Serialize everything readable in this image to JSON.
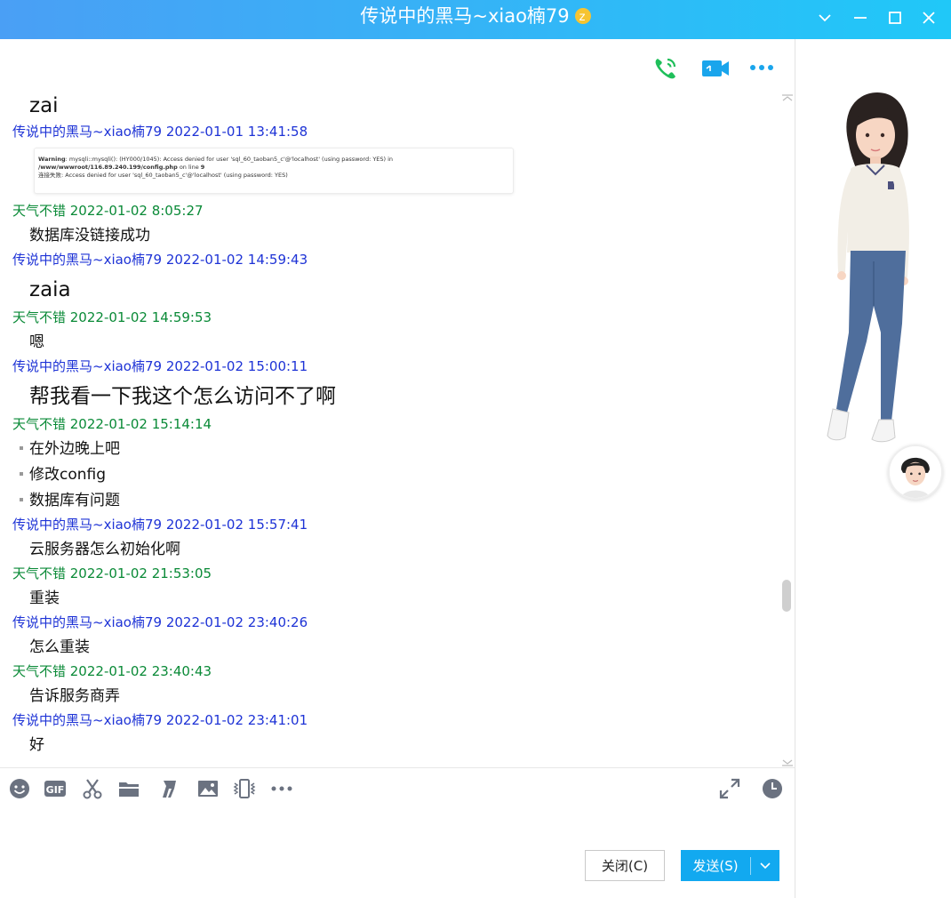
{
  "window": {
    "title": "传说中的黑马~xiao楠79"
  },
  "messages": [
    {
      "kind": "body",
      "size": "big",
      "text": "zai",
      "top": 0
    },
    {
      "kind": "meta",
      "who": "me",
      "text": "传说中的黑马~xiao楠79 2022-01-01 13:41:58"
    },
    {
      "kind": "meta",
      "who": "other",
      "text": "天气不错 2022-01-02 8:05:27"
    },
    {
      "kind": "body",
      "size": "norm",
      "text": "数据库没链接成功"
    },
    {
      "kind": "meta",
      "who": "me",
      "text": "传说中的黑马~xiao楠79 2022-01-02 14:59:43"
    },
    {
      "kind": "body",
      "size": "big",
      "text": "zaia"
    },
    {
      "kind": "meta",
      "who": "other",
      "text": "天气不错 2022-01-02 14:59:53"
    },
    {
      "kind": "body",
      "size": "norm",
      "text": "嗯"
    },
    {
      "kind": "meta",
      "who": "me",
      "text": "传说中的黑马~xiao楠79 2022-01-02 15:00:11"
    },
    {
      "kind": "body",
      "size": "big",
      "text": "帮我看一下我这个怎么访问不了啊"
    },
    {
      "kind": "meta",
      "who": "other",
      "text": "天气不错 2022-01-02 15:14:14"
    },
    {
      "kind": "bullet",
      "text": "在外边晚上吧"
    },
    {
      "kind": "bullet",
      "text": "修改config"
    },
    {
      "kind": "bullet",
      "text": "数据库有问题"
    },
    {
      "kind": "meta",
      "who": "me",
      "text": "传说中的黑马~xiao楠79 2022-01-02 15:57:41"
    },
    {
      "kind": "body",
      "size": "norm",
      "text": "云服务器怎么初始化啊"
    },
    {
      "kind": "meta",
      "who": "other",
      "text": "天气不错 2022-01-02 21:53:05"
    },
    {
      "kind": "body",
      "size": "norm",
      "text": "重装"
    },
    {
      "kind": "meta",
      "who": "me",
      "text": "传说中的黑马~xiao楠79 2022-01-02 23:40:26"
    },
    {
      "kind": "body",
      "size": "norm",
      "text": "怎么重装"
    },
    {
      "kind": "meta",
      "who": "other",
      "text": "天气不错 2022-01-02 23:40:43"
    },
    {
      "kind": "body",
      "size": "norm",
      "text": "告诉服务商弄"
    },
    {
      "kind": "meta",
      "who": "me",
      "text": "传说中的黑马~xiao楠79 2022-01-02 23:41:01"
    },
    {
      "kind": "body",
      "size": "norm",
      "text": "好"
    }
  ],
  "screenshot_text": {
    "line1_bold": "Warning",
    "line1": ": mysqli::mysqli(): (HY000/1045): Access denied for user 'sql_60_taoban5_c'@'localhost' (using password: YES) in ",
    "line1_path": "/www/wwwroot/116.89.240.199/config.php",
    "line1_end": " on line ",
    "line1_num": "9",
    "line2": "连接失败: Access denied for user 'sql_60_taoban5_c'@'localhost' (using password: YES)"
  },
  "buttons": {
    "close": "关闭(C)",
    "send": "发送(S)"
  },
  "colors": {
    "title_gradient_start": "#4a9ff5",
    "title_gradient_end": "#20c8f8",
    "me_name": "#1e33d6",
    "other_name": "#0a8a37",
    "send_button": "#12a9f0",
    "call_icon": "#1fbf5a",
    "video_icon": "#1aa5ec"
  },
  "icons": {
    "titlebar": [
      "chevron-down-icon",
      "minimize-icon",
      "maximize-icon",
      "close-icon"
    ],
    "header": [
      "phone-call-icon",
      "video-call-icon",
      "more-icon"
    ],
    "toolbar": [
      "emoji-icon",
      "gif-icon",
      "scissors-icon",
      "folder-icon",
      "music-icon",
      "image-icon",
      "shake-icon",
      "more-icon",
      "expand-icon",
      "history-clock-icon"
    ]
  }
}
